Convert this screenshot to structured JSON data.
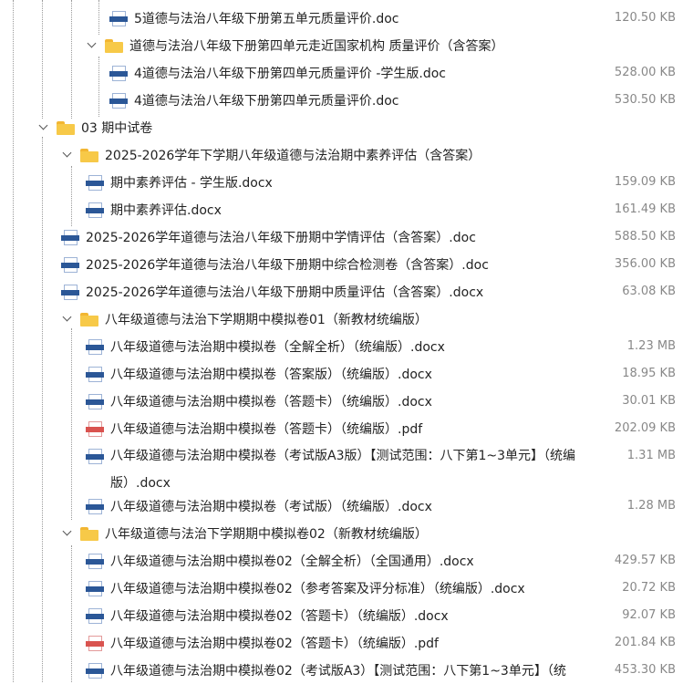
{
  "tree": {
    "rows": [
      {
        "type": "doc",
        "label": "5道德与法治八年级下册第五单元质量评价.doc",
        "size": "120.50 KB"
      },
      {
        "type": "folder",
        "label": "道德与法治八年级下册第四单元走近国家机构 质量评价（含答案）"
      },
      {
        "type": "doc",
        "label": "4道德与法治八年级下册第四单元质量评价 -学生版.doc",
        "size": "528.00 KB"
      },
      {
        "type": "doc",
        "label": "4道德与法治八年级下册第四单元质量评价.doc",
        "size": "530.50 KB"
      },
      {
        "type": "folder",
        "label": "03 期中试卷"
      },
      {
        "type": "folder",
        "label": "2025-2026学年下学期八年级道德与法治期中素养评估（含答案）"
      },
      {
        "type": "doc",
        "label": "期中素养评估 - 学生版.docx",
        "size": "159.09 KB"
      },
      {
        "type": "doc",
        "label": "期中素养评估.docx",
        "size": "161.49 KB"
      },
      {
        "type": "doc",
        "label": "2025-2026学年道德与法治八年级下册期中学情评估（含答案）.doc",
        "size": "588.50 KB"
      },
      {
        "type": "doc",
        "label": "2025-2026学年道德与法治八年级下册期中综合检测卷（含答案）.doc",
        "size": "356.00 KB"
      },
      {
        "type": "doc",
        "label": "2025-2026学年道德与法治八年级下册期中质量评估（含答案）.docx",
        "size": "63.08 KB"
      },
      {
        "type": "folder",
        "label": "八年级道德与法治下学期期中模拟卷01（新教材统编版）"
      },
      {
        "type": "doc",
        "label": "八年级道德与法治期中模拟卷（全解全析）（统编版）.docx",
        "size": "1.23 MB"
      },
      {
        "type": "doc",
        "label": "八年级道德与法治期中模拟卷（答案版）（统编版）.docx",
        "size": "18.95 KB"
      },
      {
        "type": "doc",
        "label": "八年级道德与法治期中模拟卷（答题卡）（统编版）.docx",
        "size": "30.01 KB"
      },
      {
        "type": "pdf",
        "label": "八年级道德与法治期中模拟卷（答题卡）（统编版）.pdf",
        "size": "202.09 KB"
      },
      {
        "type": "doc",
        "label": "八年级道德与法治期中模拟卷（考试版A3版）【测试范围：八下第1~3单元】（统编版）.docx",
        "size": "1.31 MB"
      },
      {
        "type": "doc",
        "label": "八年级道德与法治期中模拟卷（考试版）（统编版）.docx",
        "size": "1.28 MB"
      },
      {
        "type": "folder",
        "label": "八年级道德与法治下学期期中模拟卷02（新教材统编版）"
      },
      {
        "type": "doc",
        "label": "八年级道德与法治期中模拟卷02（全解全析）（全国通用）.docx",
        "size": "429.57 KB"
      },
      {
        "type": "doc",
        "label": "八年级道德与法治期中模拟卷02（参考答案及评分标准）（统编版）.docx",
        "size": "20.72 KB"
      },
      {
        "type": "doc",
        "label": "八年级道德与法治期中模拟卷02（答题卡）（统编版）.docx",
        "size": "92.07 KB"
      },
      {
        "type": "pdf",
        "label": "八年级道德与法治期中模拟卷02（答题卡）（统编版）.pdf",
        "size": "201.84 KB"
      },
      {
        "type": "doc",
        "label": "八年级道德与法治期中模拟卷02（考试版A3）【测试范围：八下第1~3单元】（统",
        "size": "453.30 KB"
      }
    ]
  }
}
